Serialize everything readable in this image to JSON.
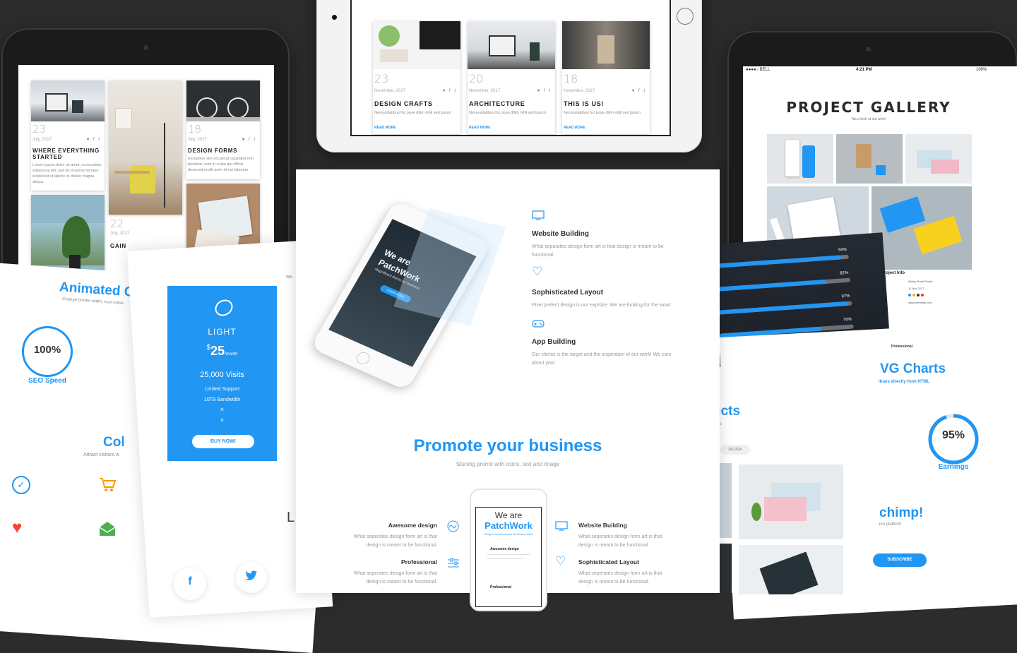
{
  "colors": {
    "accent": "#2196f3",
    "accent_dark": "#1e88e5",
    "dark_bg": "#2c2c2c",
    "heart": "#f44336",
    "cart": "#ff9800",
    "mail": "#4caf50"
  },
  "left_tablet": {
    "cards": [
      {
        "day": "23",
        "date": "July, 2017",
        "title_line1": "WHERE EVERYTHING",
        "title_line2": "STARTED",
        "text": "Lorem ipsum dolor sit amet, consectetur adipiscing elit, sed do eiusmod tempor incididunt ut labore et dolore magna aliqua."
      },
      {
        "day": "18",
        "date": "July, 2017",
        "title_line1": "DESIGN FORMS",
        "title_line2": "",
        "text": "Excepteur sint occaecat cupidatat non proident, sunt in culpa qui officia deserunt mollit anim id est laborum."
      },
      {
        "day": "22",
        "date": "July, 2017",
        "title_line1": "GAIN",
        "title_line2": "",
        "text": ""
      }
    ],
    "social": "♥ f t"
  },
  "top_tablet": {
    "cards": [
      {
        "day": "23",
        "date": "November, 2017",
        "title": "DESIGN CRAFTS",
        "text": "Necessitatibus hic pose ditim nihil sed ipsum",
        "more": "READ MORE"
      },
      {
        "day": "20",
        "date": "November, 2017",
        "title": "ARCHITECTURE",
        "text": "Necessitatibus hic pose ditim nihil sed ipsum",
        "more": "READ MORE"
      },
      {
        "day": "18",
        "date": "November, 2017",
        "title": "THIS IS US!",
        "text": "Necessitatibus hic pose ditim nihil sed ipsum",
        "more": "READ MORE"
      }
    ],
    "social": "♥ f t"
  },
  "right_tablet": {
    "status_carrier": "●●●●○ BELL",
    "status_time": "4:21 PM",
    "status_battery": "100%",
    "title": "PROJECT GALLERY",
    "subtitle": "Tak a look at our work!",
    "info_title": "Project Info",
    "info_client": "Abbey Road Studio",
    "info_date": "11 Nov 2017",
    "info_site": "www.clientsite.com"
  },
  "left_page": {
    "heading": "Animated C",
    "subheading": "Change border-width, max-value",
    "circle_value": "100%",
    "circle_label": "SEO Speed",
    "colors_heading": "Col",
    "colors_sub": "Attract visitors w"
  },
  "pricing": {
    "plan": "LIGHT",
    "currency": "$",
    "price": "25",
    "period": "/month",
    "visits": "25,000 Visits",
    "feature1": "Limited Support",
    "feature2": "10TB Bandwidth",
    "x1": "×",
    "x2": "×",
    "button": "BUY NOW!",
    "side_text": "We",
    "bottom_letter": "L"
  },
  "center": {
    "phone_headline1": "We are",
    "phone_headline2": "PatchWork",
    "phone_sub": "Magnificent theme for business",
    "phone_btn": "LEARN MORE",
    "features": [
      {
        "title": "Website Building",
        "text1": "What separates design form art is that design is meant to be",
        "text2": "functional."
      },
      {
        "title": "Sophisticated Layout",
        "text1": "Pixel prefect design is our exprtize. We are looking for the wow!",
        "text2": ""
      },
      {
        "title": "App Building",
        "text1": "Our clients is the target and the inspiration of our work! We care",
        "text2": "about you!"
      }
    ],
    "promo_title": "Promote your business",
    "promo_sub": "Stuning promo with icons, text and image",
    "mini_phone_line1": "We are",
    "mini_phone_line2": "PatchWork",
    "mini_phone_small": "Design is not how it looks but is how it works",
    "mini_phone_item1": "Awesome design",
    "mini_phone_item2": "Professional",
    "promo_left": [
      {
        "title": "Awesome design",
        "text1": "What seperates design form art is that",
        "text2": "design is meant to be functional."
      },
      {
        "title": "Professional",
        "text1": "What seperates design form art is that",
        "text2": "design is meant to be functional."
      }
    ],
    "promo_right": [
      {
        "title": "Website Building",
        "text1": "What seperates design form art is that",
        "text2": "design is meant to be functional."
      },
      {
        "title": "Sophisticated Layout",
        "text1": "What seperates design form art is that",
        "text2": "design is meant to be functional."
      }
    ]
  },
  "skills": {
    "bars": [
      {
        "label": "94%",
        "value": 0.94
      },
      {
        "label": "82%",
        "value": 0.82
      },
      {
        "label": "97%",
        "value": 0.97
      },
      {
        "label": "76%",
        "value": 0.76
      }
    ]
  },
  "right_page": {
    "projects_heading": "ects",
    "projects_sub": "cts",
    "filter_tag": "DESIGN",
    "charts_heading": "VG Charts",
    "charts_sub": "ibues directly from HTML",
    "circle_value": "95%",
    "circle_fraction": 0.95,
    "circle_label": "Earnings",
    "mailchimp_heading": "chimp!",
    "mailchimp_sub": "ion platform",
    "subscribe": "SUBSCRIBE",
    "tiny_label": "Professional"
  }
}
